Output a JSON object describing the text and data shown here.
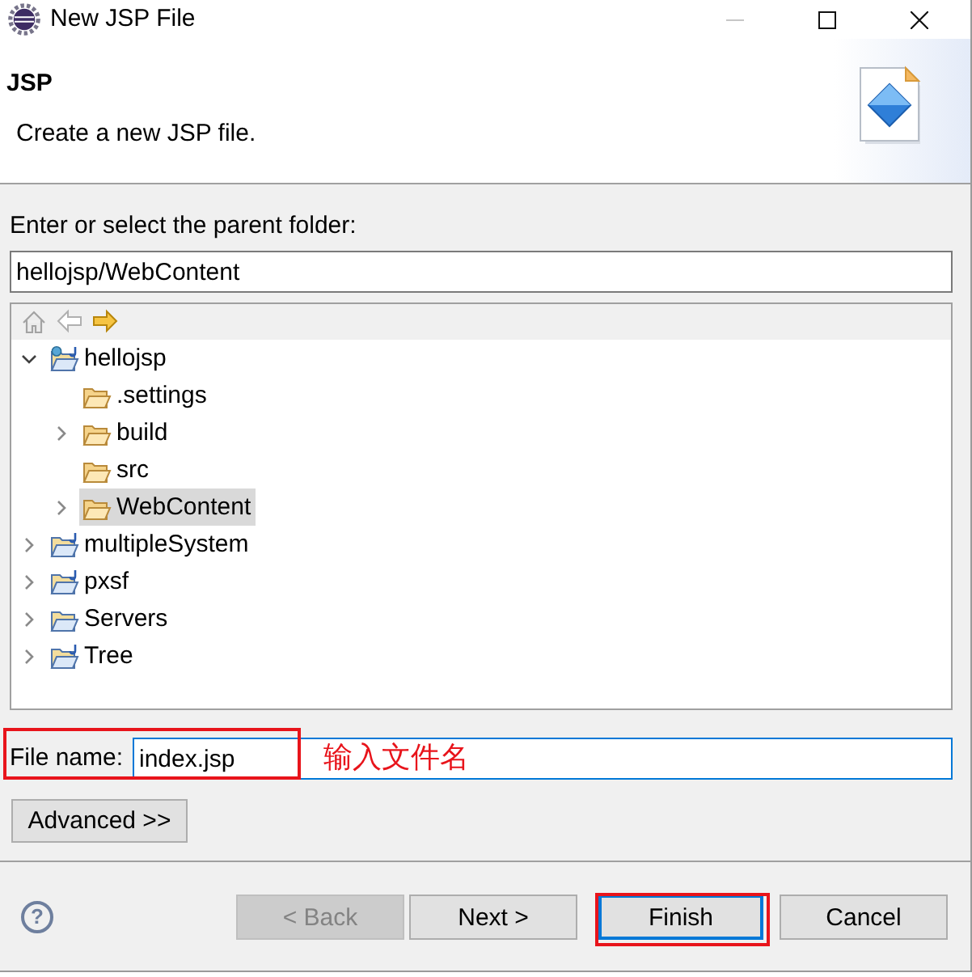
{
  "window": {
    "title": "New JSP File",
    "controls": [
      {
        "kind": "minimize",
        "disabled": true
      },
      {
        "kind": "maximize",
        "disabled": false
      },
      {
        "kind": "close",
        "disabled": false
      }
    ]
  },
  "header": {
    "title": "JSP",
    "description": "Create a new JSP file."
  },
  "parent_folder": {
    "label": "Enter or select the parent folder:",
    "value": "hellojsp/WebContent"
  },
  "tree": {
    "toolbar": [
      {
        "kind": "home",
        "disabled": true
      },
      {
        "kind": "back",
        "disabled": true
      },
      {
        "kind": "forward",
        "disabled": false
      }
    ],
    "items": [
      {
        "label": "hellojsp",
        "kind": "web-project",
        "expandable": true,
        "expanded": true,
        "selected": false,
        "children": [
          {
            "label": ".settings",
            "kind": "folder",
            "expandable": false,
            "expanded": false,
            "selected": false
          },
          {
            "label": "build",
            "kind": "folder",
            "expandable": true,
            "expanded": false,
            "selected": false
          },
          {
            "label": "src",
            "kind": "folder",
            "expandable": false,
            "expanded": false,
            "selected": false
          },
          {
            "label": "WebContent",
            "kind": "folder",
            "expandable": true,
            "expanded": false,
            "selected": true
          }
        ]
      },
      {
        "label": "multipleSystem",
        "kind": "java-project",
        "expandable": true,
        "expanded": false,
        "selected": false
      },
      {
        "label": "pxsf",
        "kind": "java-project",
        "expandable": true,
        "expanded": false,
        "selected": false
      },
      {
        "label": "Servers",
        "kind": "project",
        "expandable": true,
        "expanded": false,
        "selected": false
      },
      {
        "label": "Tree",
        "kind": "java-project",
        "expandable": true,
        "expanded": false,
        "selected": false
      }
    ]
  },
  "file_name": {
    "label": "File name:",
    "value": "index.jsp",
    "focused": true,
    "highlighted": true,
    "note": "输入文件名"
  },
  "advanced": {
    "label": "Advanced >>"
  },
  "help": {
    "symbol": "?"
  },
  "buttons": [
    {
      "label": "< Back",
      "disabled": true,
      "default": false,
      "highlighted": false
    },
    {
      "label": "Next >",
      "disabled": false,
      "default": false,
      "highlighted": false
    },
    {
      "label": "Finish",
      "disabled": false,
      "default": true,
      "highlighted": true
    },
    {
      "label": "Cancel",
      "disabled": false,
      "default": false,
      "highlighted": false
    }
  ]
}
